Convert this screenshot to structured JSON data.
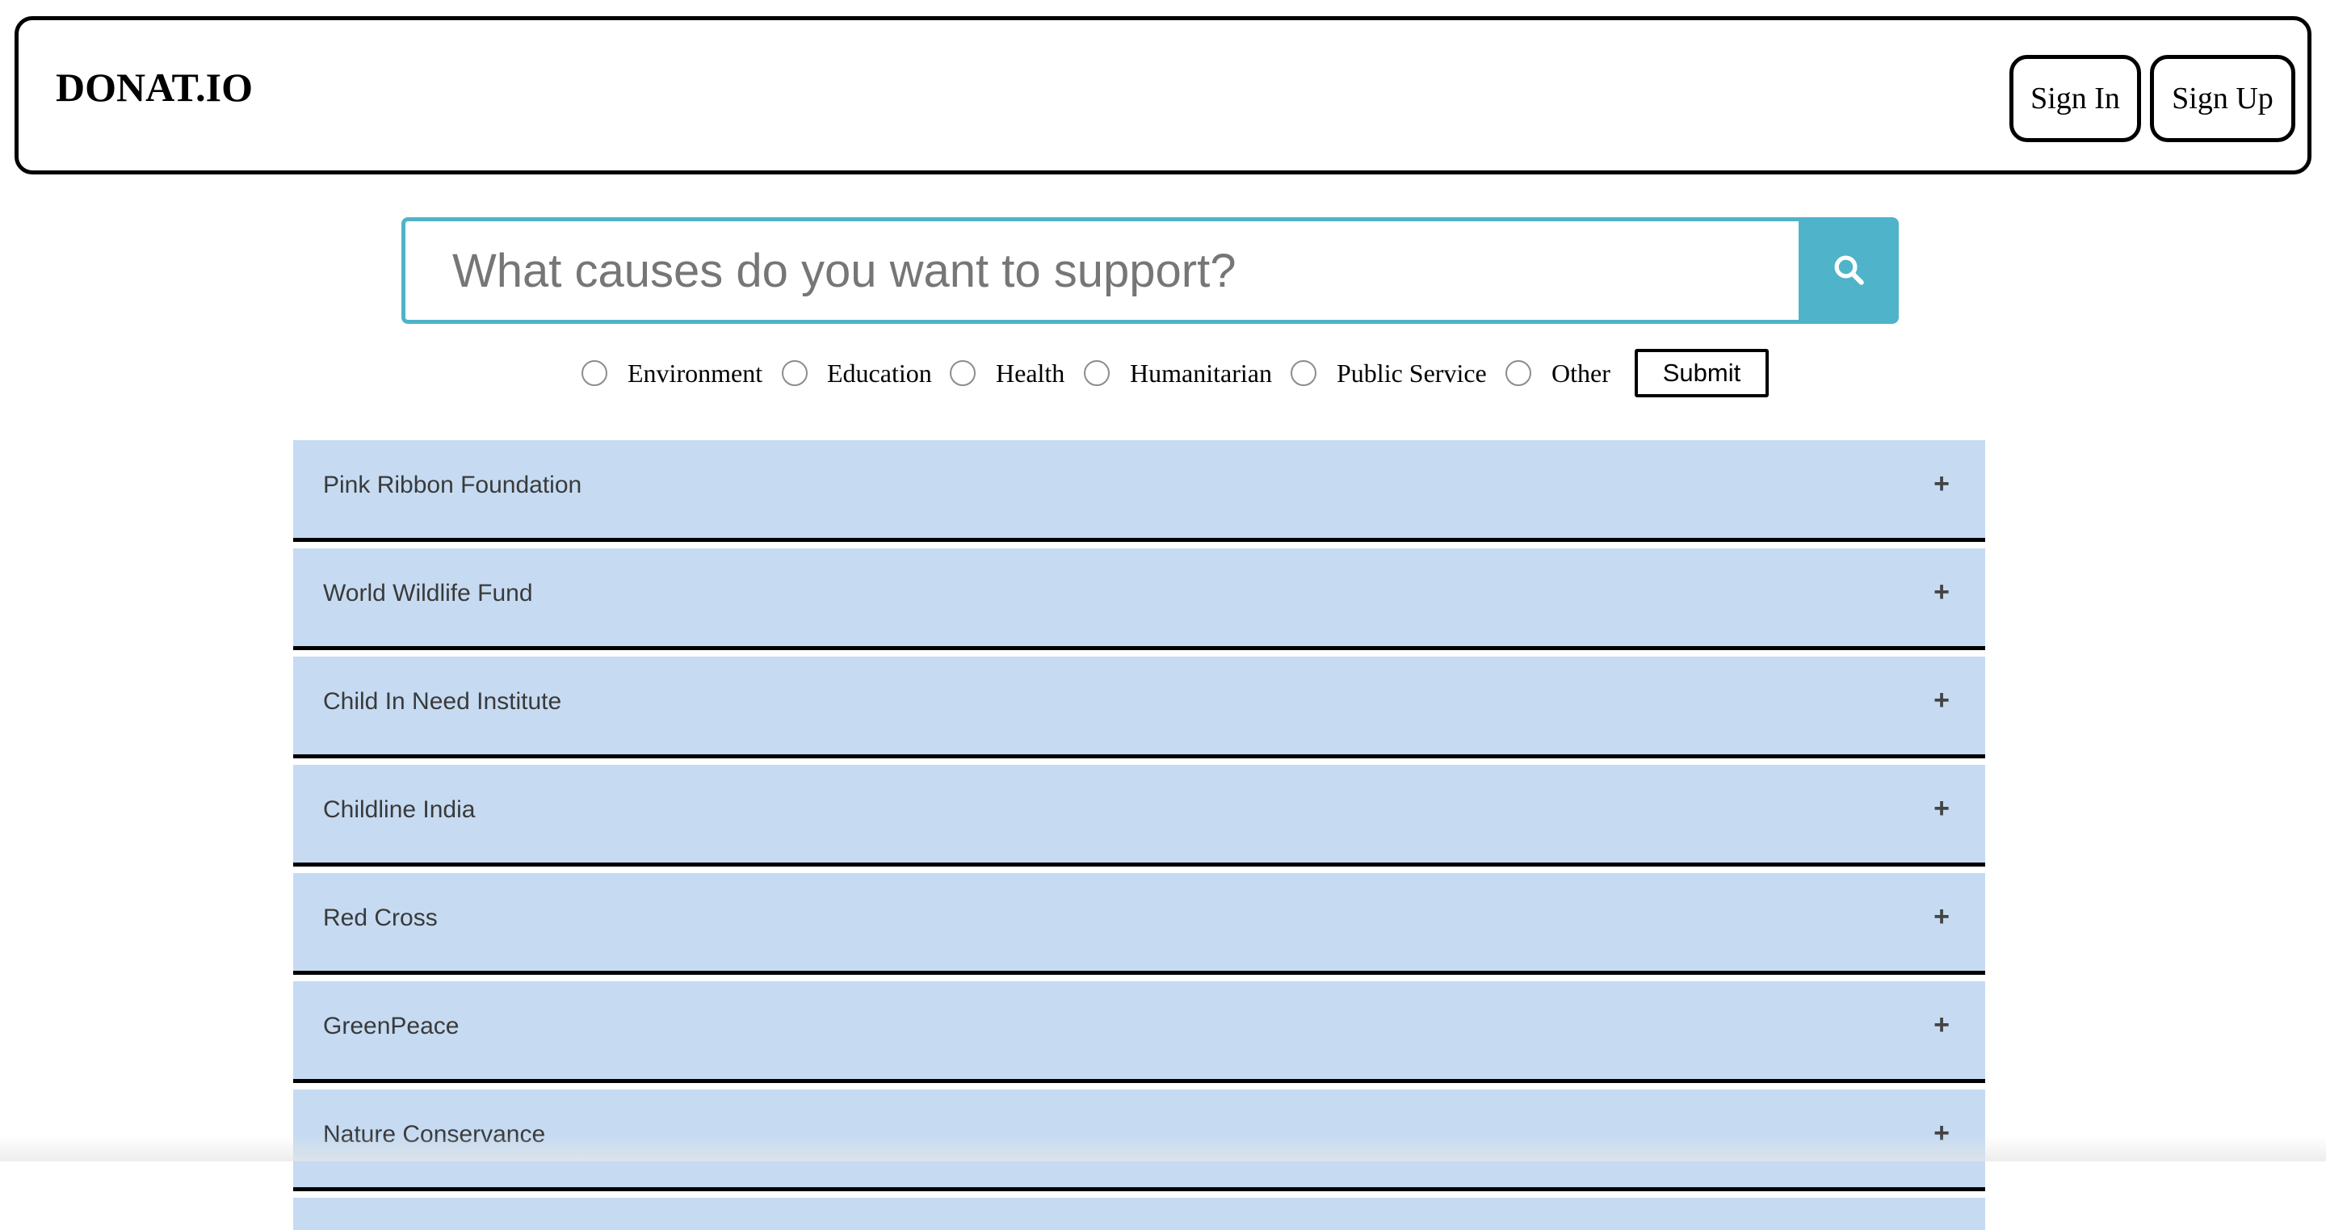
{
  "header": {
    "logo": "DONAT.IO",
    "sign_in_label": "Sign In",
    "sign_up_label": "Sign Up"
  },
  "search": {
    "placeholder": "What causes do you want to support?",
    "value": "",
    "button_icon": "search-icon",
    "accent_color": "#4fb3c9"
  },
  "filters": {
    "options": [
      "Environment",
      "Education",
      "Health",
      "Humanitarian",
      "Public Service",
      "Other"
    ],
    "submit_label": "Submit"
  },
  "charities": {
    "expand_icon": "+",
    "row_color": "#c6dbf2",
    "items": [
      "Pink Ribbon Foundation",
      "World Wildlife Fund",
      "Child In Need Institute",
      "Childline India",
      "Red Cross",
      "GreenPeace",
      "Nature Conservance"
    ]
  }
}
